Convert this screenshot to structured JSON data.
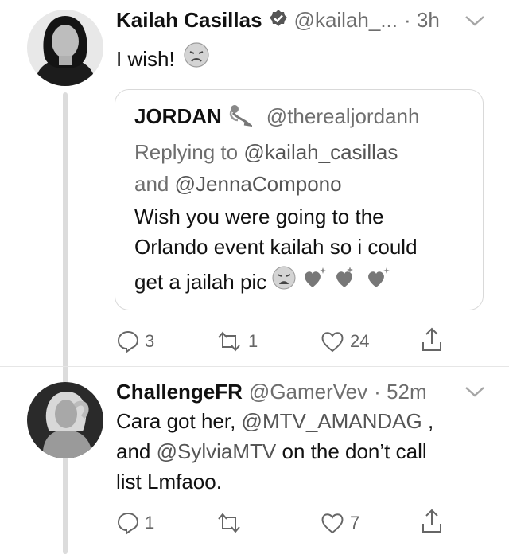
{
  "tweet1": {
    "author_name": "Kailah Casillas",
    "handle": "@kailah_...",
    "time": "· 3h",
    "text": "I wish!",
    "emoji_icon": "disappointed-face-icon",
    "quote": {
      "author_name": "JORDAN",
      "handle": "@therealjordanh",
      "reply_prefix": "Replying to",
      "reply_user1": "@kailah_casillas",
      "reply_and": "and",
      "reply_user2": "@JennaCompono",
      "line1": "Wish you were going to the",
      "line2": "Orlando event kailah so i could",
      "line3": "get a jailah pic"
    },
    "actions": {
      "replies": "3",
      "retweets": "1",
      "likes": "24"
    }
  },
  "tweet2": {
    "author_name": "ChallengeFR",
    "handle": "@GamerVev",
    "time": "· 52m",
    "text_part1": "Cara got her,",
    "mention1": "@MTV_AMANDAG",
    "text_part2": ",",
    "text_part3": "and",
    "mention2": "@SylviaMTV",
    "text_part4": "on the don’t call",
    "text_part5": "list Lmfaoo.",
    "actions": {
      "replies": "1",
      "retweets": "",
      "likes": "7"
    }
  }
}
